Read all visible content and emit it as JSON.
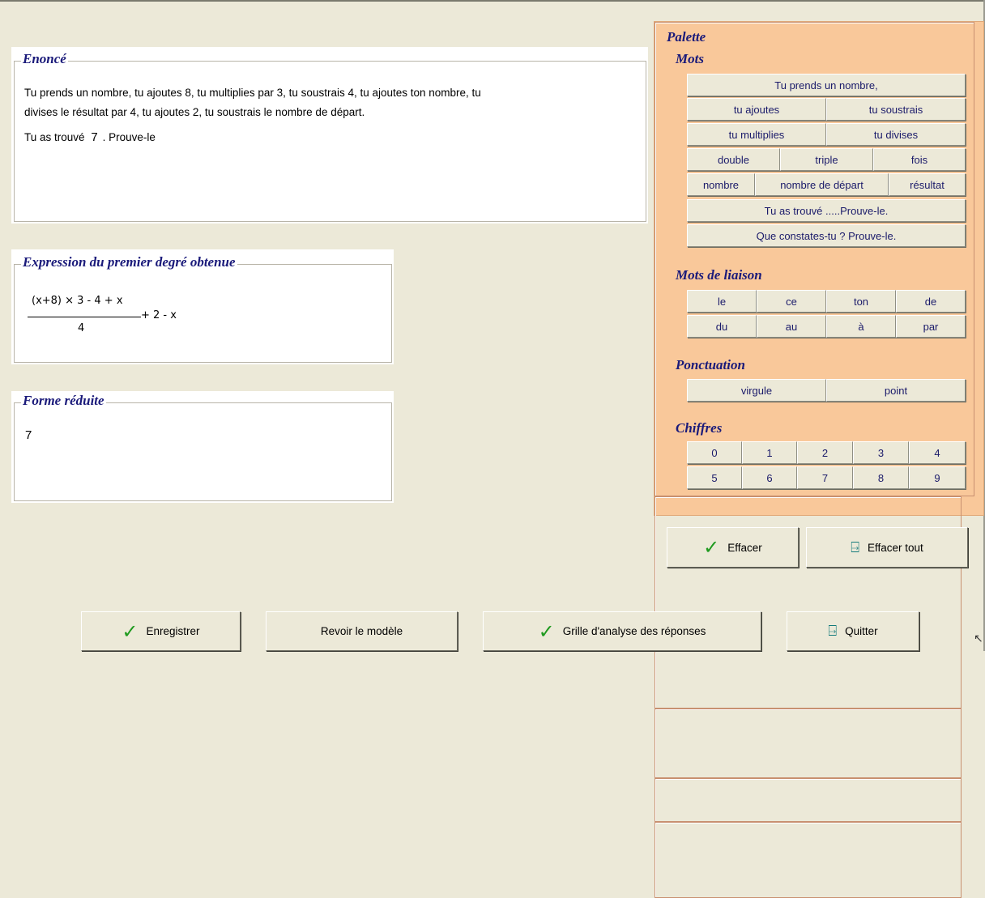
{
  "enonce": {
    "title": "Enoncé",
    "line1": "Tu prends un nombre, tu ajoutes 8, tu multiplies par 3, tu soustrais 4, tu ajoutes ton nombre, tu",
    "line2": "divises le résultat par 4, tu ajoutes 2, tu soustrais le nombre de départ.",
    "line3_pre": "Tu as trouvé",
    "line3_value": "7",
    "line3_post": ". Prouve-le"
  },
  "expression": {
    "title": "Expression du premier degré obtenue",
    "numerator": "(x+8) × 3 - 4 + x",
    "denominator": "4",
    "tail": "+ 2 - x"
  },
  "forme": {
    "title": "Forme réduite",
    "value": "7"
  },
  "palette": {
    "title": "Palette",
    "mots": {
      "title": "Mots",
      "items": [
        "Tu prends un nombre,",
        "tu ajoutes",
        "tu soustrais",
        "tu multiplies",
        "tu divises",
        "double",
        "triple",
        "fois",
        "nombre",
        "nombre de départ",
        "résultat",
        "Tu as trouvé .....Prouve-le.",
        "Que constates-tu ? Prouve-le."
      ]
    },
    "liaison": {
      "title": "Mots de liaison",
      "items": [
        "le",
        "ce",
        "ton",
        "de",
        "du",
        "au",
        "à",
        "par"
      ]
    },
    "ponctuation": {
      "title": "Ponctuation",
      "items": [
        "virgule",
        "point"
      ]
    },
    "chiffres": {
      "title": "Chiffres",
      "items": [
        "0",
        "1",
        "2",
        "3",
        "4",
        "5",
        "6",
        "7",
        "8",
        "9"
      ]
    }
  },
  "actions": {
    "effacer": "Effacer",
    "effacer_tout": "Effacer tout",
    "enregistrer": "Enregistrer",
    "revoir": "Revoir le modèle",
    "grille": "Grille d'analyse des réponses",
    "quitter": "Quitter"
  },
  "icons": {
    "check": "check-icon",
    "exit": "exit-door-icon"
  },
  "colors": {
    "palette_bg": "#f9c89a",
    "title_blue": "#1a1a7a",
    "check_green": "#1f9a1f"
  }
}
